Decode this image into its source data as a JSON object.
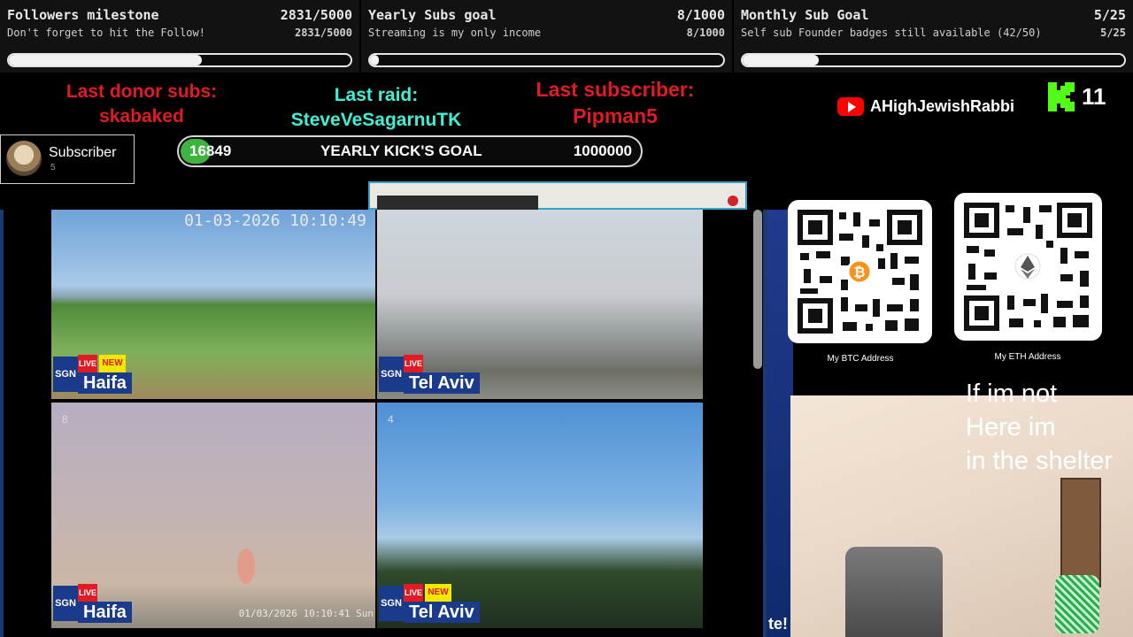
{
  "goals": [
    {
      "title": "Followers milestone",
      "value": "2831/5000",
      "subtitle": "Don't forget to hit the Follow!",
      "subvalue": "2831/5000",
      "progress": 0.566
    },
    {
      "title": "Yearly Subs goal",
      "value": "8/1000",
      "subtitle": "Streaming is my only income",
      "subvalue": "8/1000",
      "progress": 0.008
    },
    {
      "title": "Monthly Sub Goal",
      "value": "5/25",
      "subtitle": "Self sub Founder badges still available (42/50)",
      "subvalue": "5/25",
      "progress": 0.2
    }
  ],
  "last_info": {
    "donor_label": "Last donor subs:",
    "donor_name": "skabaked",
    "raid_label": "Last raid:",
    "raid_name": "SteveVeSagarnuTK",
    "sub_label": "Last subscriber:",
    "sub_name": "Pipman5"
  },
  "kick_goal": {
    "current": "16849",
    "label": "YEARLY KICK'S GOAL",
    "target": "1000000"
  },
  "subscriber_card": {
    "label": "Subscriber",
    "count": "5"
  },
  "socials": {
    "youtube_name": "AHighJewishRabbi",
    "kick_count": "11",
    "youtube_icon": "youtube-icon",
    "kick_icon": "kick-icon"
  },
  "cameras": [
    {
      "city": "Haifa",
      "timestamp": "01-03-2026 10:10:49",
      "live": "LIVE",
      "new": "NEW",
      "number": ""
    },
    {
      "city": "Tel Aviv",
      "timestamp": "",
      "live": "LIVE",
      "new": "",
      "number": ""
    },
    {
      "city": "Haifa",
      "timestamp": "01/03/2026 10:10:41 Sun",
      "live": "LIVE",
      "new": "",
      "number": "8"
    },
    {
      "city": "Tel Aviv",
      "timestamp": "",
      "live": "LIVE",
      "new": "NEW",
      "number": "4"
    }
  ],
  "brand_tag": "SGN",
  "right_panel": {
    "side_text": "te!",
    "btc_caption": "My BTC Address",
    "eth_caption": "My ETH Address",
    "shelter_text": "If im not\nHere im\nin the shelter"
  },
  "colors": {
    "accent_red": "#e01b24",
    "accent_cyan": "#3ef0d6",
    "kick_green": "#53fc18",
    "bar_fill": "#f2f2f2"
  }
}
